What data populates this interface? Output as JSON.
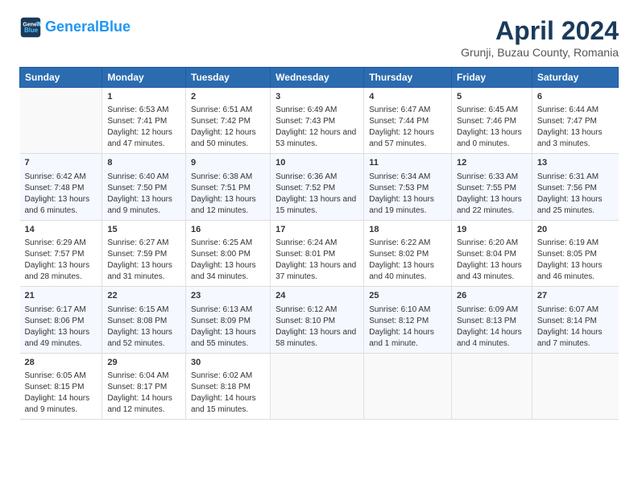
{
  "logo": {
    "line1": "General",
    "line2": "Blue"
  },
  "title": "April 2024",
  "subtitle": "Grunji, Buzau County, Romania",
  "headers": [
    "Sunday",
    "Monday",
    "Tuesday",
    "Wednesday",
    "Thursday",
    "Friday",
    "Saturday"
  ],
  "weeks": [
    [
      {
        "day": "",
        "content": ""
      },
      {
        "day": "1",
        "sunrise": "6:53 AM",
        "sunset": "7:41 PM",
        "daylight": "12 hours and 47 minutes."
      },
      {
        "day": "2",
        "sunrise": "6:51 AM",
        "sunset": "7:42 PM",
        "daylight": "12 hours and 50 minutes."
      },
      {
        "day": "3",
        "sunrise": "6:49 AM",
        "sunset": "7:43 PM",
        "daylight": "12 hours and 53 minutes."
      },
      {
        "day": "4",
        "sunrise": "6:47 AM",
        "sunset": "7:44 PM",
        "daylight": "12 hours and 57 minutes."
      },
      {
        "day": "5",
        "sunrise": "6:45 AM",
        "sunset": "7:46 PM",
        "daylight": "13 hours and 0 minutes."
      },
      {
        "day": "6",
        "sunrise": "6:44 AM",
        "sunset": "7:47 PM",
        "daylight": "13 hours and 3 minutes."
      }
    ],
    [
      {
        "day": "7",
        "sunrise": "6:42 AM",
        "sunset": "7:48 PM",
        "daylight": "13 hours and 6 minutes."
      },
      {
        "day": "8",
        "sunrise": "6:40 AM",
        "sunset": "7:50 PM",
        "daylight": "13 hours and 9 minutes."
      },
      {
        "day": "9",
        "sunrise": "6:38 AM",
        "sunset": "7:51 PM",
        "daylight": "13 hours and 12 minutes."
      },
      {
        "day": "10",
        "sunrise": "6:36 AM",
        "sunset": "7:52 PM",
        "daylight": "13 hours and 15 minutes."
      },
      {
        "day": "11",
        "sunrise": "6:34 AM",
        "sunset": "7:53 PM",
        "daylight": "13 hours and 19 minutes."
      },
      {
        "day": "12",
        "sunrise": "6:33 AM",
        "sunset": "7:55 PM",
        "daylight": "13 hours and 22 minutes."
      },
      {
        "day": "13",
        "sunrise": "6:31 AM",
        "sunset": "7:56 PM",
        "daylight": "13 hours and 25 minutes."
      }
    ],
    [
      {
        "day": "14",
        "sunrise": "6:29 AM",
        "sunset": "7:57 PM",
        "daylight": "13 hours and 28 minutes."
      },
      {
        "day": "15",
        "sunrise": "6:27 AM",
        "sunset": "7:59 PM",
        "daylight": "13 hours and 31 minutes."
      },
      {
        "day": "16",
        "sunrise": "6:25 AM",
        "sunset": "8:00 PM",
        "daylight": "13 hours and 34 minutes."
      },
      {
        "day": "17",
        "sunrise": "6:24 AM",
        "sunset": "8:01 PM",
        "daylight": "13 hours and 37 minutes."
      },
      {
        "day": "18",
        "sunrise": "6:22 AM",
        "sunset": "8:02 PM",
        "daylight": "13 hours and 40 minutes."
      },
      {
        "day": "19",
        "sunrise": "6:20 AM",
        "sunset": "8:04 PM",
        "daylight": "13 hours and 43 minutes."
      },
      {
        "day": "20",
        "sunrise": "6:19 AM",
        "sunset": "8:05 PM",
        "daylight": "13 hours and 46 minutes."
      }
    ],
    [
      {
        "day": "21",
        "sunrise": "6:17 AM",
        "sunset": "8:06 PM",
        "daylight": "13 hours and 49 minutes."
      },
      {
        "day": "22",
        "sunrise": "6:15 AM",
        "sunset": "8:08 PM",
        "daylight": "13 hours and 52 minutes."
      },
      {
        "day": "23",
        "sunrise": "6:13 AM",
        "sunset": "8:09 PM",
        "daylight": "13 hours and 55 minutes."
      },
      {
        "day": "24",
        "sunrise": "6:12 AM",
        "sunset": "8:10 PM",
        "daylight": "13 hours and 58 minutes."
      },
      {
        "day": "25",
        "sunrise": "6:10 AM",
        "sunset": "8:12 PM",
        "daylight": "14 hours and 1 minute."
      },
      {
        "day": "26",
        "sunrise": "6:09 AM",
        "sunset": "8:13 PM",
        "daylight": "14 hours and 4 minutes."
      },
      {
        "day": "27",
        "sunrise": "6:07 AM",
        "sunset": "8:14 PM",
        "daylight": "14 hours and 7 minutes."
      }
    ],
    [
      {
        "day": "28",
        "sunrise": "6:05 AM",
        "sunset": "8:15 PM",
        "daylight": "14 hours and 9 minutes."
      },
      {
        "day": "29",
        "sunrise": "6:04 AM",
        "sunset": "8:17 PM",
        "daylight": "14 hours and 12 minutes."
      },
      {
        "day": "30",
        "sunrise": "6:02 AM",
        "sunset": "8:18 PM",
        "daylight": "14 hours and 15 minutes."
      },
      {
        "day": "",
        "content": ""
      },
      {
        "day": "",
        "content": ""
      },
      {
        "day": "",
        "content": ""
      },
      {
        "day": "",
        "content": ""
      }
    ]
  ]
}
